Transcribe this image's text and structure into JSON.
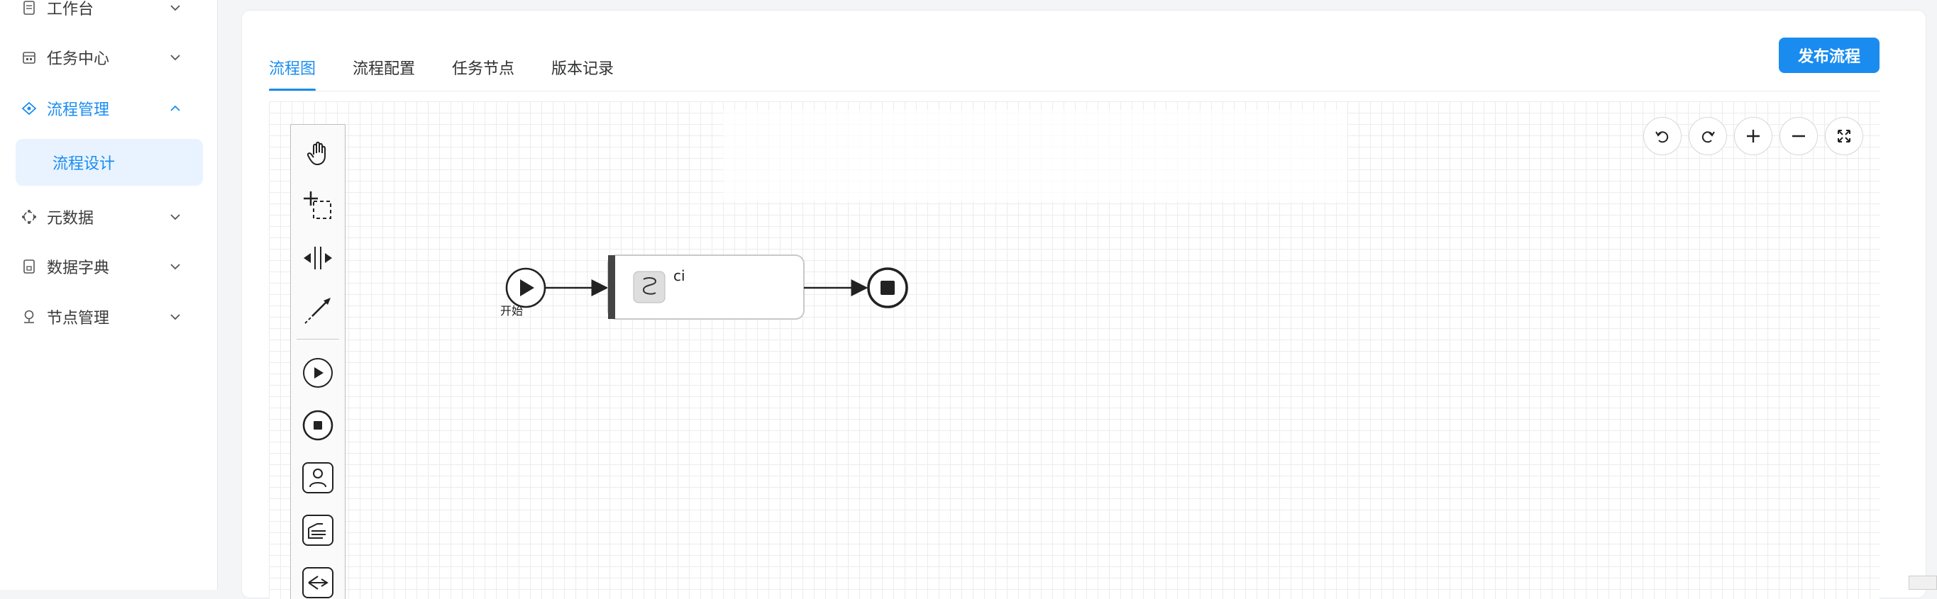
{
  "sidebar": {
    "items": [
      {
        "label": "工作台",
        "icon": "document-icon",
        "expanded": false
      },
      {
        "label": "任务中心",
        "icon": "calendar-icon",
        "expanded": false
      },
      {
        "label": "流程管理",
        "icon": "flow-icon",
        "expanded": true,
        "active": true
      },
      {
        "label": "元数据",
        "icon": "metadata-icon",
        "expanded": false
      },
      {
        "label": "数据字典",
        "icon": "dictionary-icon",
        "expanded": false
      },
      {
        "label": "节点管理",
        "icon": "node-icon",
        "expanded": false
      }
    ],
    "submenu": {
      "label": "流程设计",
      "active": true
    }
  },
  "tabs": [
    {
      "label": "流程图",
      "active": true
    },
    {
      "label": "流程配置",
      "active": false
    },
    {
      "label": "任务节点",
      "active": false
    },
    {
      "label": "版本记录",
      "active": false
    }
  ],
  "publish_label": "发布流程",
  "diagram": {
    "start_label": "开始",
    "task_label": "ci"
  },
  "palette_tools": [
    "hand-tool-icon",
    "lasso-tool-icon",
    "space-tool-icon",
    "connect-tool-icon",
    "start-event-icon",
    "end-event-icon",
    "user-task-icon",
    "manual-task-icon",
    "gateway-icon"
  ],
  "canvas_controls": [
    "undo-icon",
    "redo-icon",
    "zoom-in-icon",
    "zoom-out-icon",
    "fit-screen-icon"
  ],
  "colors": {
    "accent": "#1a8cf0",
    "active_bg": "#e8f3ff"
  }
}
